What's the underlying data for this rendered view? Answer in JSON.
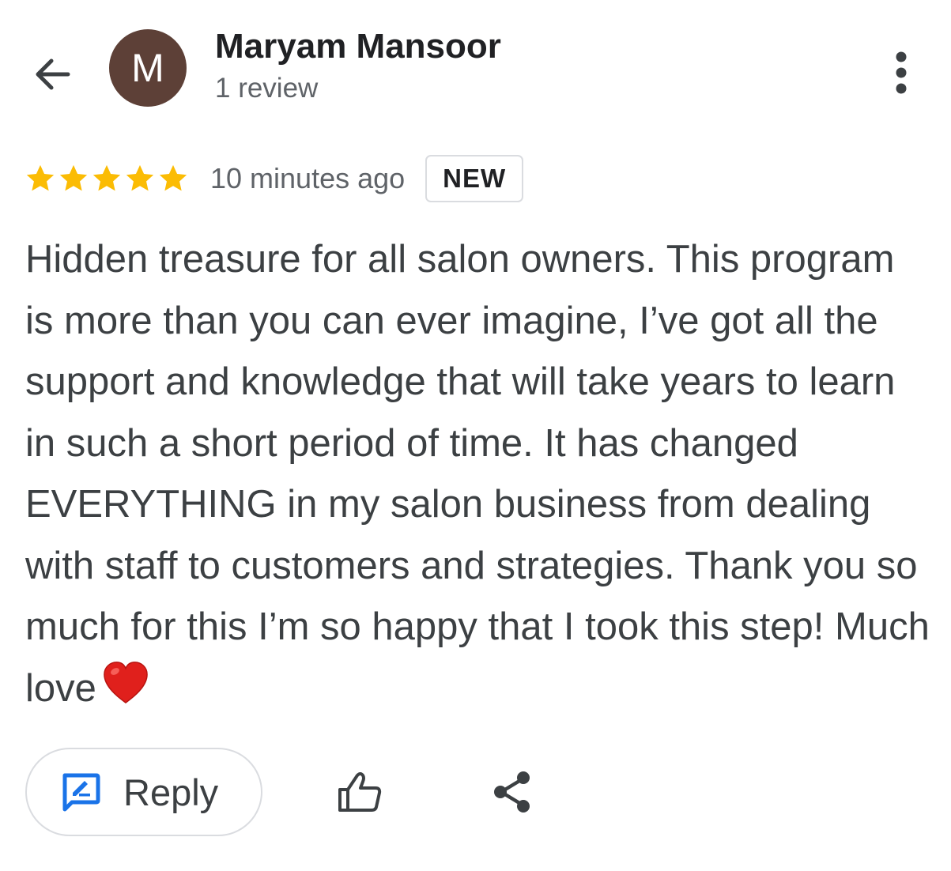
{
  "header": {
    "back_icon": "arrow-back-icon",
    "avatar_letter": "M",
    "avatar_color": "#5d4037",
    "author_name": "Maryam Mansoor",
    "review_count": "1 review",
    "more_icon": "more-vert-icon"
  },
  "review": {
    "rating": 5,
    "max_rating": 5,
    "star_color": "#fbbc04",
    "timestamp": "10 minutes ago",
    "badge": "NEW",
    "text": "Hidden treasure for all salon owners. This program is more than you can ever imagine, I’ve got all the support and knowledge that will take years to learn in such a short period of time. It has changed EVERYTHING in my salon business from dealing with staff to customers and strategies. Thank you so much for this I’m so happy that I took this step! Much love",
    "emoji_icon": "red-heart-icon"
  },
  "actions": {
    "reply_label": "Reply",
    "reply_icon": "rate-review-icon",
    "reply_icon_color": "#1a73e8",
    "like_icon": "thumb-up-icon",
    "share_icon": "share-icon"
  }
}
